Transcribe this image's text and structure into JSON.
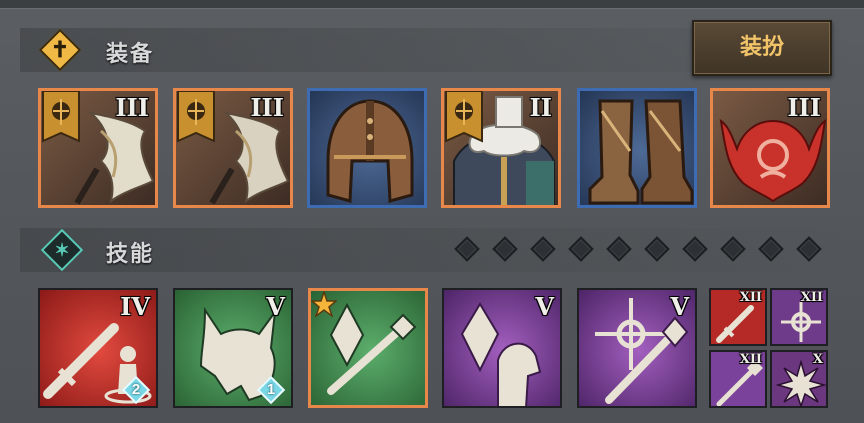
{
  "equipment": {
    "title": "装备",
    "dress_button": "装扮",
    "items": [
      {
        "name": "sword-blade",
        "tier": "III"
      },
      {
        "name": "sword-blade",
        "tier": "III"
      },
      {
        "name": "helmet",
        "tier": ""
      },
      {
        "name": "fur-armor",
        "tier": "II"
      },
      {
        "name": "boots",
        "tier": ""
      },
      {
        "name": "phoenix-emblem",
        "tier": "III"
      }
    ]
  },
  "skills": {
    "title": "技能",
    "pip_count": 10,
    "items": [
      {
        "name": "sword-guard-skill",
        "tier": "IV",
        "badge": "2"
      },
      {
        "name": "wolf-skill",
        "tier": "V",
        "badge": "1"
      },
      {
        "name": "crystal-staff-skill",
        "tier": ""
      },
      {
        "name": "crystal-cloak-skill",
        "tier": "V"
      },
      {
        "name": "holy-staff-skill",
        "tier": "V"
      }
    ],
    "small_items": [
      {
        "name": "sword-small",
        "tier": "XII"
      },
      {
        "name": "holy-target",
        "tier": "XII"
      },
      {
        "name": "staff-small",
        "tier": "XII"
      },
      {
        "name": "burst-small",
        "tier": "X"
      }
    ]
  },
  "colors": {
    "orange_border": "#e7884a",
    "blue_border": "#3d6cb3",
    "gold": "#f2c46a",
    "teal": "#58c9b5"
  }
}
